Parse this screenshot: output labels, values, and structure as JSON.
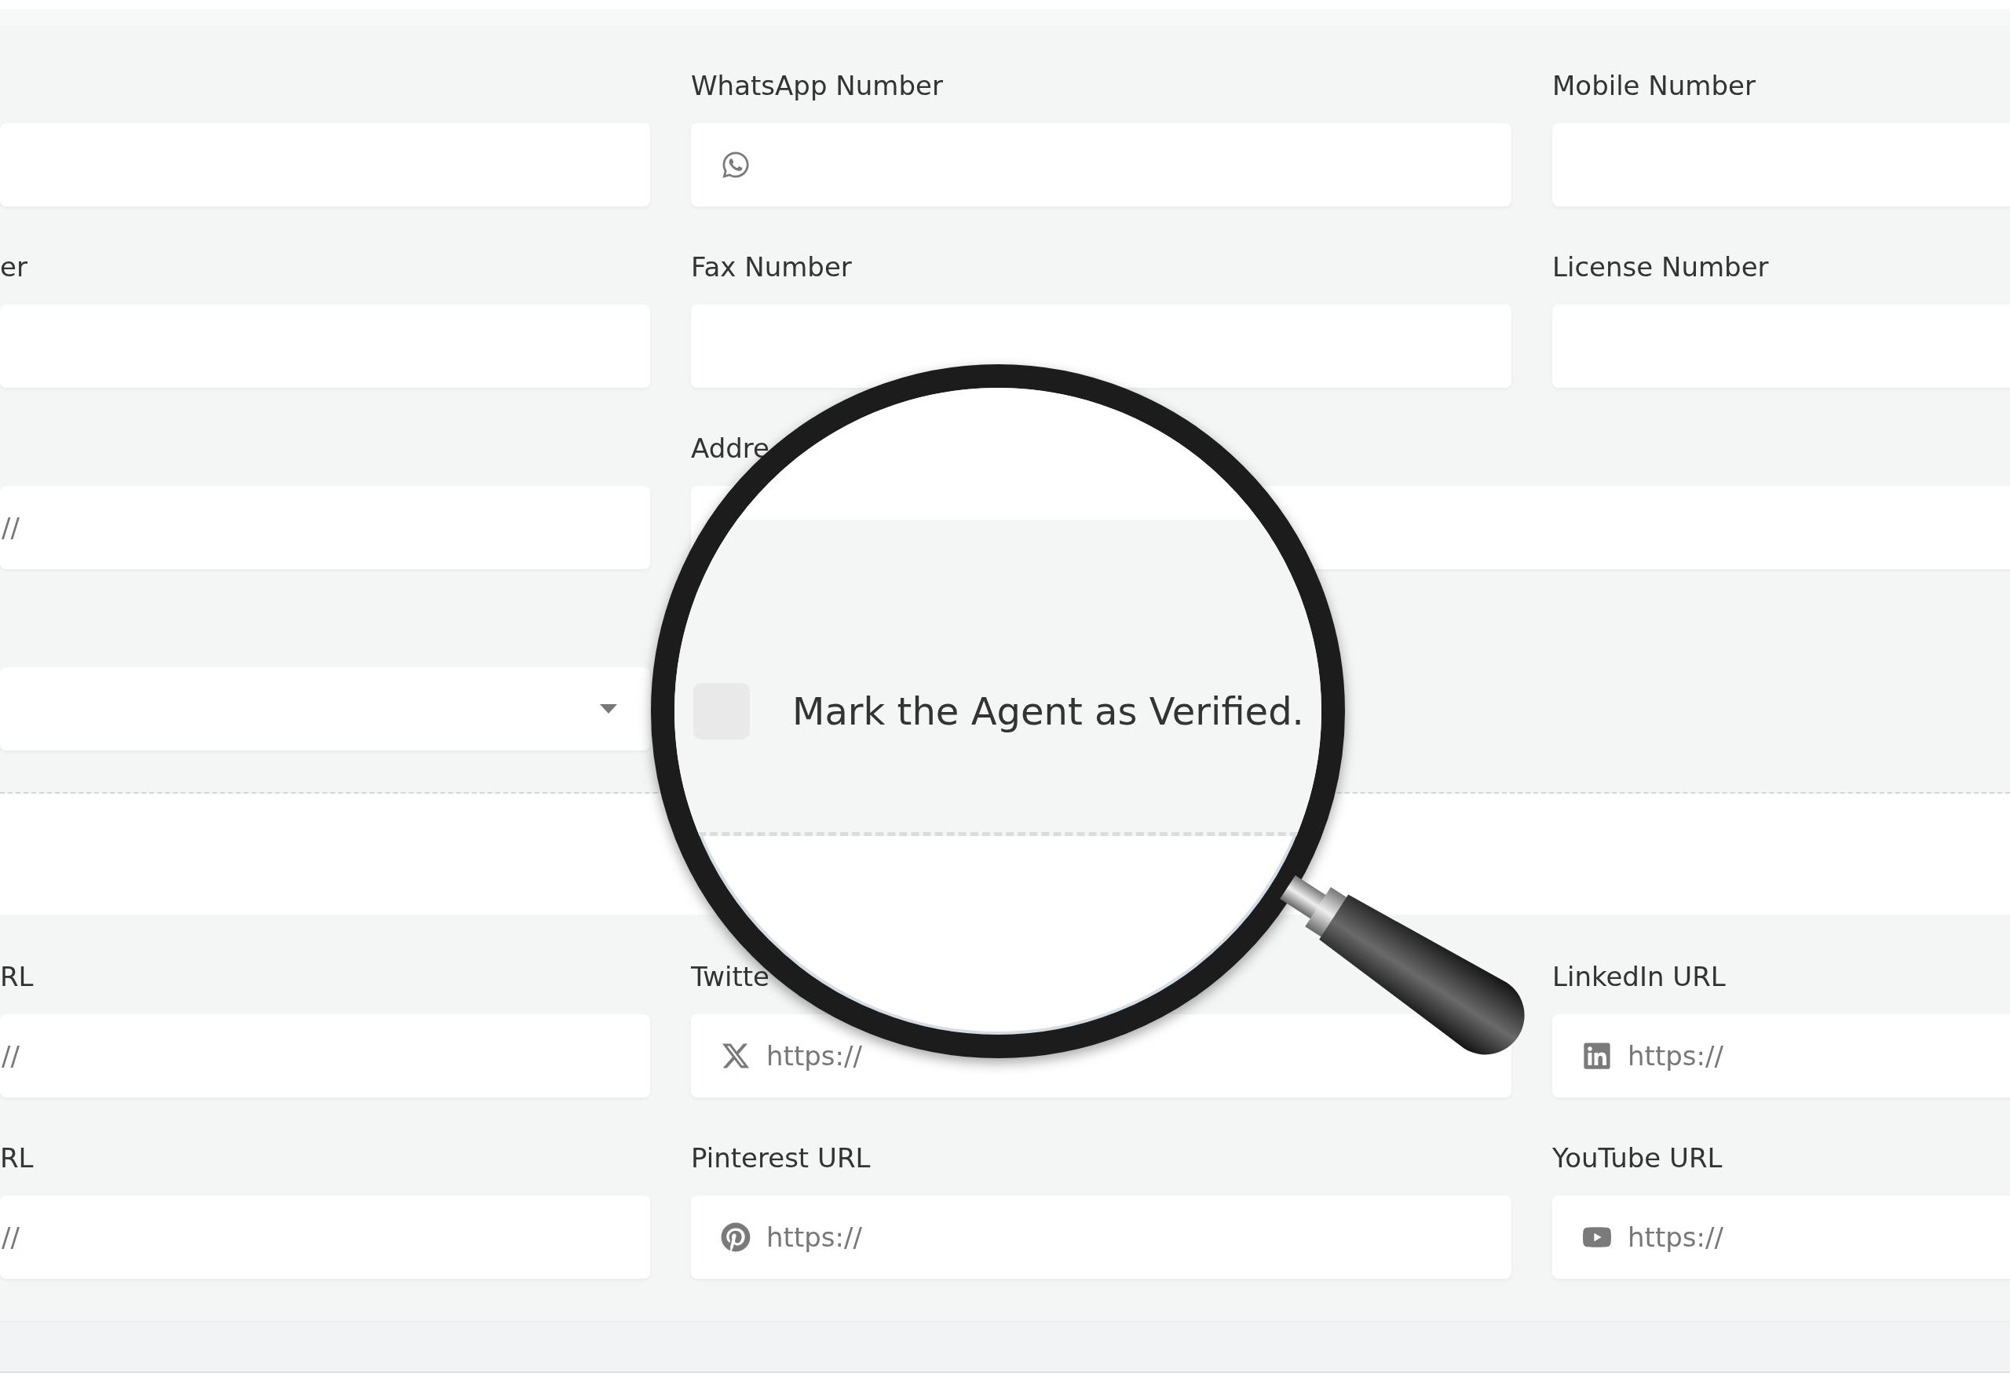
{
  "profile_section": {
    "fields": [
      {
        "kind": "text"
      },
      {
        "kind": "text",
        "label": "WhatsApp Number"
      },
      {
        "kind": "text",
        "label": "Mobile Number"
      },
      {
        "kind": "text",
        "label": "er"
      },
      {
        "kind": "text",
        "label": "Fax Number"
      },
      {
        "kind": "text",
        "label": "License Number"
      },
      {
        "kind": "text",
        "placeholder": "//"
      },
      {
        "kind": "wide",
        "label": "Addre"
      },
      {
        "kind": "select"
      }
    ]
  },
  "social_section": {
    "fields": [
      {
        "kind": "text",
        "label": "RL",
        "placeholder": "//"
      },
      {
        "kind": "text",
        "label": "Twitte",
        "placeholder": "https://"
      },
      {
        "kind": "text",
        "label": "LinkedIn URL",
        "placeholder": "https://"
      },
      {
        "kind": "text",
        "label": "RL",
        "placeholder": "//"
      },
      {
        "kind": "text",
        "label": "Pinterest URL",
        "placeholder": "https://"
      },
      {
        "kind": "text",
        "label": "YouTube URL",
        "placeholder": "https://"
      }
    ]
  },
  "magnifier": {
    "checkbox": {
      "label": "Mark the Agent as Verified.",
      "checked": false
    }
  }
}
